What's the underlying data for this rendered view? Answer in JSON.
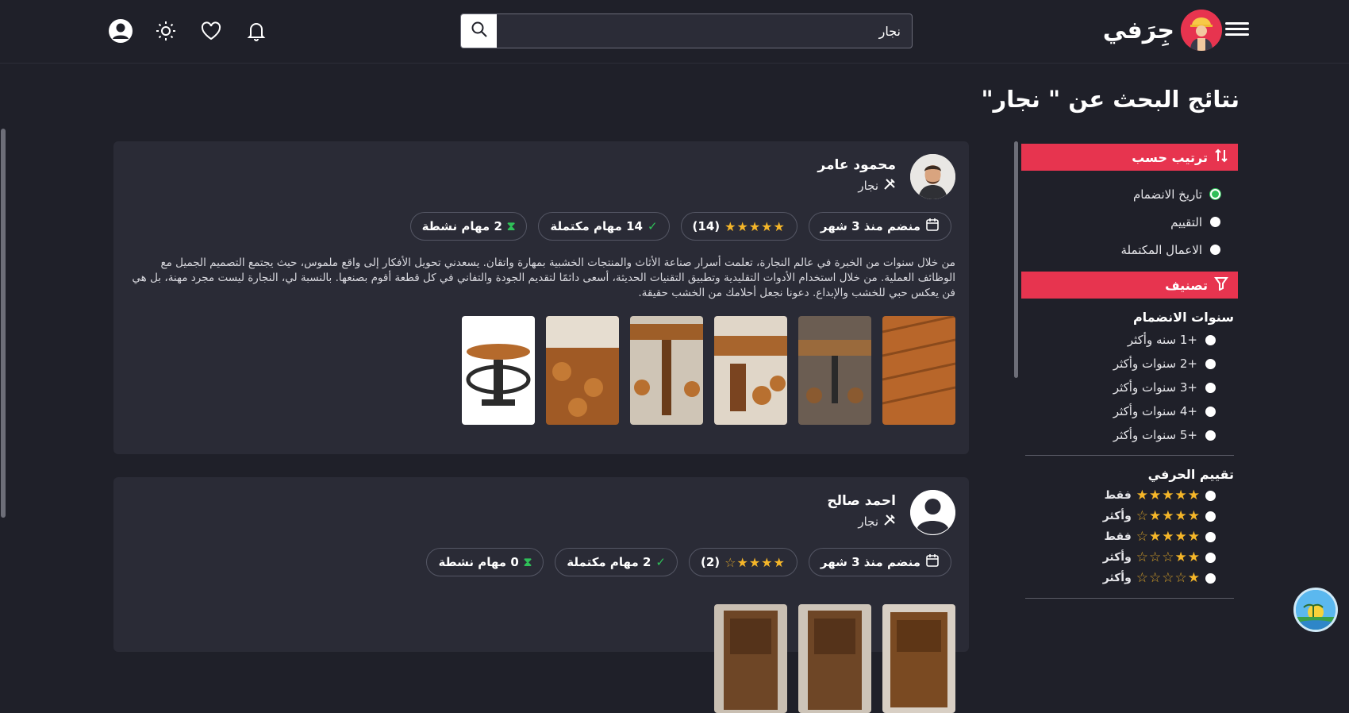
{
  "header": {
    "brand": "جِرَفي",
    "search_value": "نجار",
    "icons": [
      "user-icon",
      "sun-icon",
      "heart-icon",
      "bell-icon",
      "search-icon",
      "menu-icon"
    ]
  },
  "page_title": "نتائج البحث عن \" نجار\"",
  "sidebar": {
    "sort_title": "ترتيب حسب",
    "sort_options": [
      {
        "label": "تاريخ الانضمام",
        "selected": true
      },
      {
        "label": "التقييم",
        "selected": false
      },
      {
        "label": "الاعمال المكتملة",
        "selected": false
      }
    ],
    "filter_title": "تصنيف",
    "years_title": "سنوات الانضمام",
    "years_options": [
      "+1 سنه وأكثر",
      "+2 سنوات وأكثر",
      "+3 سنوات وأكثر",
      "+4 سنوات وأكثر",
      "+5 سنوات وأكثر"
    ],
    "rating_title": "تقييم الحرفي",
    "rating_options": [
      {
        "stars": 5,
        "label": "فقط"
      },
      {
        "stars": 4,
        "label": "وأكثر"
      },
      {
        "stars": 4,
        "label": "فقط"
      },
      {
        "stars": 2,
        "label": "وأكثر"
      },
      {
        "stars": 1,
        "label": "وأكثر"
      }
    ]
  },
  "results": [
    {
      "name": "محمود عامر",
      "job": "نجار",
      "joined": "منضم منذ 3 شهر",
      "rating_stars": 5,
      "rating_count": "(14)",
      "completed": "14 مهام مكتملة",
      "active": "2 مهام نشطة",
      "description": "من خلال سنوات من الخبرة في عالم النجارة، تعلمت أسرار صناعة الأثاث والمنتجات الخشبية بمهارة واتقان. يسعدني تحويل الأفكار إلى واقع ملموس، حيث يجتمع التصميم الجميل مع الوظائف العملية. من خلال استخدام الأدوات التقليدية وتطبيق التقنيات الحديثة، أسعى دائمًا لتقديم الجودة والتفاني في كل قطعة أقوم بصنعها. بالنسبة لي، النجارة ليست مجرد مهنة، بل هي فن يعكس حبي للخشب والإبداع. دعونا نجعل أحلامك من الخشب حقيقة."
    },
    {
      "name": "احمد صالح",
      "job": "نجار",
      "joined": "منضم منذ 3 شهر",
      "rating_stars": 4,
      "rating_count": "(2)",
      "completed": "2 مهام مكتملة",
      "active": "0 مهام نشطة"
    }
  ],
  "colors": {
    "accent": "#e7344f",
    "background": "#1f2029",
    "card": "#2a2b36",
    "star": "#f5b629",
    "check": "#2fbf58"
  }
}
